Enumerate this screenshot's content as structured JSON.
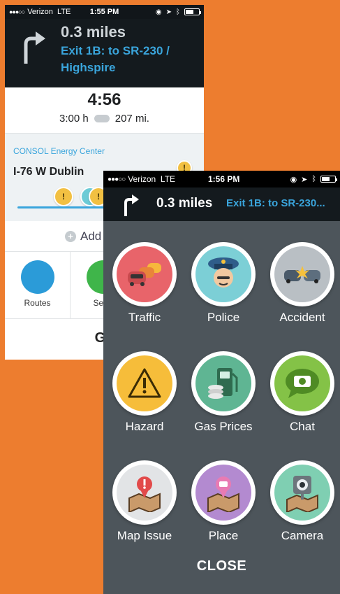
{
  "back_screen": {
    "status": {
      "signal": "●●●○○",
      "carrier": "Verizon",
      "network": "LTE",
      "time": "1:55 PM"
    },
    "turn": {
      "distance": "0.3 miles",
      "exit_line1": "Exit 1B: to SR-230 /",
      "exit_line2": "Highspire"
    },
    "eta": {
      "arrival": "4:56",
      "duration": "3:00 h",
      "distance": "207 mi."
    },
    "route": {
      "destination": "CONSOL Energy Center",
      "road": "I-76 W Dublin"
    },
    "add_label": "Add",
    "actions": [
      {
        "label": "Routes",
        "icon": "routes-icon",
        "color": "#2b9bd8"
      },
      {
        "label": "Send",
        "icon": "send-eta-icon",
        "color": "#3fb54a"
      }
    ],
    "go_label": "Go"
  },
  "report_screen": {
    "status": {
      "signal": "●●●○○",
      "carrier": "Verizon",
      "network": "LTE",
      "time": "1:56 PM"
    },
    "turn": {
      "distance": "0.3 miles",
      "exit": "Exit 1B: to SR-230..."
    },
    "items": [
      {
        "label": "Traffic",
        "icon": "traffic-icon",
        "color": "#e8646a"
      },
      {
        "label": "Police",
        "icon": "police-icon",
        "color": "#7ccfd6"
      },
      {
        "label": "Accident",
        "icon": "accident-icon",
        "color": "#b9bfc4"
      },
      {
        "label": "Hazard",
        "icon": "hazard-icon",
        "color": "#f6bd3a"
      },
      {
        "label": "Gas Prices",
        "icon": "gas-prices-icon",
        "color": "#5fb593"
      },
      {
        "label": "Chat",
        "icon": "chat-icon",
        "color": "#84c247"
      },
      {
        "label": "Map Issue",
        "icon": "map-issue-icon",
        "color": "#e2e4e6"
      },
      {
        "label": "Place",
        "icon": "place-icon",
        "color": "#b38ad0"
      },
      {
        "label": "Camera",
        "icon": "camera-icon",
        "color": "#7fcfb2"
      }
    ],
    "close_label": "CLOSE"
  },
  "colors": {
    "background": "#ED7D2F",
    "accent": "#3aa5dc"
  }
}
